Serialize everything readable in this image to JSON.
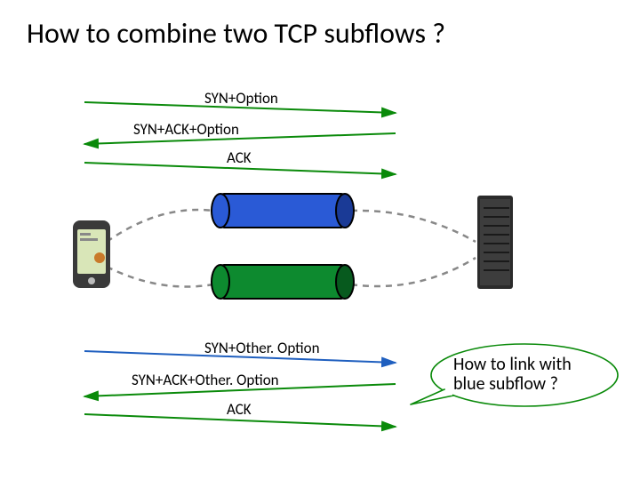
{
  "title": "How to combine two TCP subflows ?",
  "messages": {
    "syn1": "SYN+Option",
    "synack1": "SYN+ACK+Option",
    "ack1": "ACK",
    "syn2": "SYN+Other. Option",
    "synack2": "SYN+ACK+Other. Option",
    "ack2": "ACK"
  },
  "callout": {
    "line1": "How to link with",
    "line2": "blue subflow ?"
  }
}
